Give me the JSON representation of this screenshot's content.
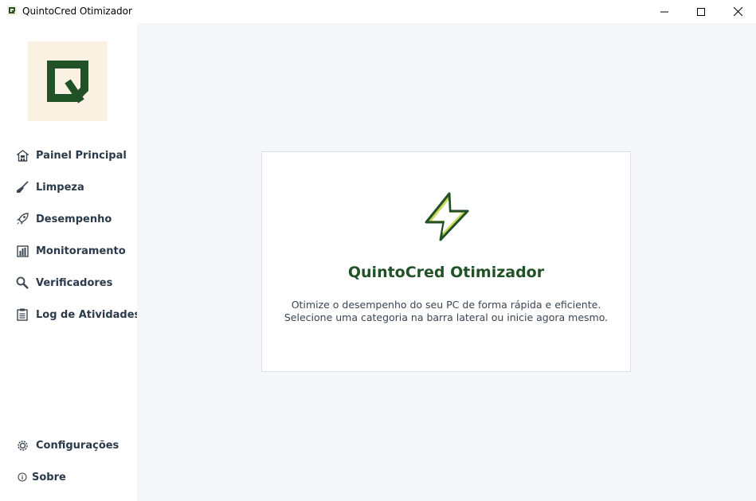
{
  "window": {
    "title": "QuintoCred Otimizador",
    "controls": {
      "minimize": "minimize-icon",
      "maximize": "maximize-icon",
      "close": "close-icon"
    }
  },
  "sidebar": {
    "logo_icon": "quintocred-logo",
    "items": [
      {
        "label": "Painel Principal",
        "icon": "home-icon"
      },
      {
        "label": "Limpeza",
        "icon": "broom-icon"
      },
      {
        "label": "Desempenho",
        "icon": "rocket-icon"
      },
      {
        "label": "Monitoramento",
        "icon": "bar-chart-icon"
      },
      {
        "label": "Verificadores",
        "icon": "magnifier-icon"
      },
      {
        "label": "Log de Atividades",
        "icon": "clipboard-icon"
      }
    ],
    "bottom_items": [
      {
        "label": "Configurações",
        "icon": "gear-icon"
      },
      {
        "label": "Sobre",
        "icon": "info-icon"
      }
    ]
  },
  "welcome": {
    "icon": "lightning-icon",
    "title": "QuintoCred Otimizador",
    "description_line1": "Otimize o desempenho do seu PC de forma rápida e eficiente.",
    "description_line2": "Selecione uma categoria na barra lateral ou inicie agora mesmo."
  },
  "colors": {
    "brand_green": "#215126",
    "logo_background": "#fbf1e2",
    "lightning_fill": "#c9d85a",
    "main_background": "#f5f6fa",
    "nav_text": "#2b3a4a"
  }
}
